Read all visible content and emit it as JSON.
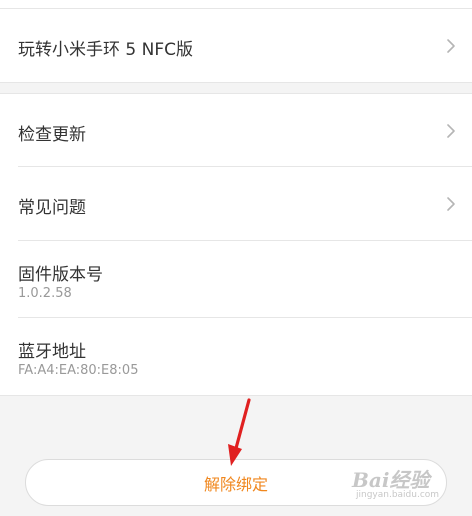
{
  "top_group": {
    "guide_label": "玩转小米手环 5 NFC版"
  },
  "info_group": {
    "update_label": "检查更新",
    "faq_label": "常见问题",
    "firmware_label": "固件版本号",
    "firmware_value": "1.0.2.58",
    "bluetooth_label": "蓝牙地址",
    "bluetooth_value": "FA:A4:EA:80:E8:05"
  },
  "unbind": {
    "label": "解除绑定",
    "color": "#f0871e"
  },
  "icons": {
    "chevron": "chevron-right-icon",
    "arrow": "red-arrow-annotation"
  },
  "watermark": {
    "main": "Bai经验",
    "sub": "jingyan.baidu.com"
  }
}
